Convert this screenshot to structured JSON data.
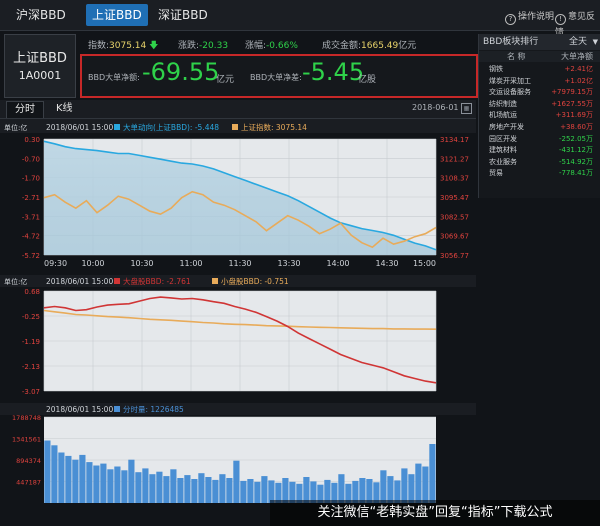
{
  "tabs": [
    {
      "label": "沪深BBD",
      "active": false
    },
    {
      "label": "上证BBD",
      "active": true
    },
    {
      "label": "深证BBD",
      "active": false
    }
  ],
  "top_links": {
    "help": "操作说明",
    "feedback": "意见反馈"
  },
  "index": {
    "name": "上证BBD",
    "code": "1A0001",
    "index_label": "指数:",
    "index_value": "3075.14",
    "change_label": "涨跌:",
    "change_value": "-20.33",
    "pct_label": "涨幅:",
    "pct_value": "-0.66%",
    "turnover_label": "成交金额:",
    "turnover_value": "1665.49",
    "turnover_unit": "亿元"
  },
  "net": {
    "amount_label": "BBD大单净额:",
    "amount_value": "-69.55",
    "amount_unit": "亿元",
    "diff_label": "BBD大单净差:",
    "diff_value": "-5.45",
    "diff_unit": "亿股"
  },
  "sidebar": {
    "title": "BBD板块排行",
    "range": "全天",
    "col_name": "名 称",
    "col_value": "大单净额",
    "rows": [
      {
        "name": "钢铁",
        "value": "+2.41亿"
      },
      {
        "name": "煤炭开采加工",
        "value": "+1.02亿"
      },
      {
        "name": "交运设备服务",
        "value": "+7979.15万"
      },
      {
        "name": "纺织制造",
        "value": "+1627.55万"
      },
      {
        "name": "机场航运",
        "value": "+311.69万"
      },
      {
        "name": "房地产开发",
        "value": "+38.60万"
      },
      {
        "name": "园区开发",
        "value": "-252.05万"
      },
      {
        "name": "建筑材料",
        "value": "-431.12万"
      },
      {
        "name": "农业服务",
        "value": "-514.92万"
      },
      {
        "name": "贸易",
        "value": "-778.41万"
      }
    ]
  },
  "chart_tabs": [
    {
      "label": "分时",
      "active": true
    },
    {
      "label": "K线",
      "active": false
    }
  ],
  "date": "2018-06-01",
  "colors": {
    "accent": "#1f6fb5",
    "up": "#e0433e",
    "down": "#2fd24a",
    "bbd_line": "#29a8e0",
    "index_line": "#e8ab5a",
    "large_line": "#d03535",
    "small_line": "#e8ab5a",
    "volume_bar": "#4a8fd4",
    "highlight": "#c62828"
  },
  "chart_data": [
    {
      "type": "line",
      "unit_label": "单位:亿",
      "header_time": "2018/06/01 15:00",
      "x_ticks": [
        "09:30",
        "10:00",
        "10:30",
        "11:00",
        "11:30",
        "13:30",
        "14:00",
        "14:30",
        "15:00"
      ],
      "left_ticks": [
        "0.30",
        "-0.70",
        "-1.70",
        "-2.71",
        "-3.71",
        "-4.72",
        "-5.72"
      ],
      "right_ticks": [
        "3134.17",
        "3121.27",
        "3108.37",
        "3095.47",
        "3082.57",
        "3069.67",
        "3056.77"
      ],
      "ylim_left": [
        -5.72,
        0.3
      ],
      "ylim_right": [
        3056.77,
        3134.17
      ],
      "series": [
        {
          "name": "大单动向(上证BBD)",
          "value": "-5.448",
          "axis": "left",
          "values": [
            0.18,
            0.05,
            -0.1,
            -0.2,
            -0.25,
            -0.3,
            -0.38,
            -0.45,
            -0.45,
            -0.55,
            -0.65,
            -0.75,
            -0.85,
            -0.95,
            -1.0,
            -1.1,
            -1.25,
            -1.45,
            -1.65,
            -1.85,
            -2.05,
            -2.25,
            -2.45,
            -2.65,
            -2.9,
            -3.2,
            -3.5,
            -3.8,
            -4.05,
            -4.2,
            -4.35,
            -4.45,
            -4.55,
            -4.7,
            -4.9,
            -5.1,
            -5.25,
            -5.448
          ]
        },
        {
          "name": "上证指数",
          "value": "3075.14",
          "axis": "right",
          "values": [
            3095,
            3097,
            3092,
            3088,
            3093,
            3085,
            3090,
            3096,
            3094,
            3090,
            3086,
            3084,
            3088,
            3095,
            3099,
            3097,
            3092,
            3090,
            3087,
            3083,
            3079,
            3073,
            3078,
            3083,
            3080,
            3076,
            3071,
            3074,
            3078,
            3070,
            3065,
            3062,
            3068,
            3064,
            3066,
            3069,
            3071,
            3075.14
          ]
        }
      ]
    },
    {
      "type": "line",
      "unit_label": "单位:亿",
      "header_time": "2018/06/01 15:00",
      "left_ticks": [
        "0.68",
        "-0.25",
        "-1.19",
        "-2.13",
        "-3.07"
      ],
      "ylim": [
        -3.07,
        0.68
      ],
      "series": [
        {
          "name": "大盘股BBD",
          "value": "-2.761",
          "values": [
            0.05,
            0.1,
            0.05,
            -0.05,
            -0.02,
            0.08,
            0.15,
            0.18,
            0.2,
            0.3,
            0.4,
            0.45,
            0.42,
            0.38,
            0.4,
            0.35,
            0.28,
            0.22,
            0.1,
            0.0,
            -0.12,
            -0.28,
            -0.45,
            -0.65,
            -0.9,
            -1.1,
            -1.3,
            -1.5,
            -1.7,
            -1.85,
            -2.0,
            -2.1,
            -2.2,
            -2.35,
            -2.5,
            -2.6,
            -2.7,
            -2.761
          ]
        },
        {
          "name": "小盘股BBD",
          "value": "-0.751",
          "values": [
            -0.05,
            -0.1,
            -0.15,
            -0.2,
            -0.22,
            -0.25,
            -0.28,
            -0.3,
            -0.32,
            -0.35,
            -0.38,
            -0.4,
            -0.42,
            -0.45,
            -0.47,
            -0.5,
            -0.52,
            -0.55,
            -0.57,
            -0.58,
            -0.6,
            -0.62,
            -0.63,
            -0.64,
            -0.66,
            -0.67,
            -0.68,
            -0.69,
            -0.7,
            -0.71,
            -0.72,
            -0.73,
            -0.73,
            -0.74,
            -0.74,
            -0.75,
            -0.75,
            -0.751
          ]
        }
      ]
    },
    {
      "type": "bar",
      "header_time": "2018/06/01 15:00",
      "series_name": "分时量",
      "series_value": "1226485",
      "left_ticks": [
        "1788748",
        "1341561",
        "894374",
        "447187"
      ],
      "ylim": [
        0,
        1788748
      ],
      "values": [
        1300000,
        1200000,
        1050000,
        980000,
        900000,
        1000000,
        850000,
        780000,
        820000,
        700000,
        760000,
        680000,
        900000,
        640000,
        720000,
        600000,
        650000,
        560000,
        700000,
        520000,
        580000,
        500000,
        620000,
        540000,
        480000,
        600000,
        520000,
        880000,
        460000,
        500000,
        440000,
        560000,
        470000,
        420000,
        520000,
        440000,
        400000,
        540000,
        450000,
        380000,
        480000,
        420000,
        600000,
        400000,
        460000,
        520000,
        500000,
        430000,
        680000,
        560000,
        470000,
        720000,
        600000,
        820000,
        760000,
        1226485
      ]
    }
  ],
  "watermark": "关注微信“老韩实盘”回复“指标”下载公式"
}
